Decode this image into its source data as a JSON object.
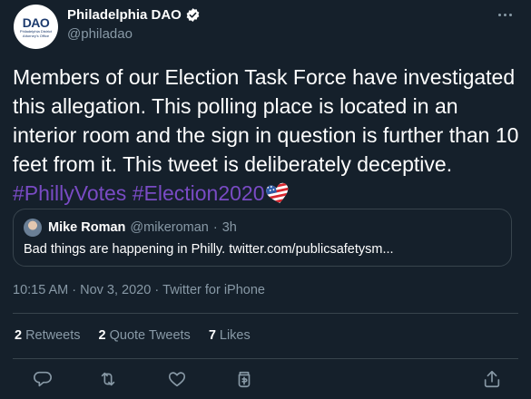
{
  "author": {
    "display_name": "Philadelphia DAO",
    "handle": "@philadao",
    "logo_text": "DAO",
    "logo_sub": "Philadelphia District Attorney's Office"
  },
  "tweet": {
    "text_before": "Members of our Election Task Force have investigated this allegation. This polling place is located in an interior room and the sign in question is further than 10 feet from it. This tweet is deliberately deceptive. ",
    "hashtag_1": "#PhillyVotes",
    "hashtag_2": "#Election2020"
  },
  "quote": {
    "name": "Mike Roman",
    "handle": "@mikeroman",
    "separator": "·",
    "time": "3h",
    "text": "Bad things are happening in Philly. twitter.com/publicsafetysm..."
  },
  "meta": {
    "time": "10:15 AM",
    "separator_1": "·",
    "date": "Nov 3, 2020",
    "separator_2": "·",
    "source": "Twitter for iPhone"
  },
  "stats": {
    "retweets_count": "2",
    "retweets_label": "Retweets",
    "quotes_count": "2",
    "quotes_label": "Quote Tweets",
    "likes_count": "7",
    "likes_label": "Likes"
  },
  "icons": {
    "verified": "verified-badge-icon",
    "more": "more-options-icon",
    "reply": "reply-icon",
    "retweet": "retweet-icon",
    "like": "like-heart-icon",
    "tip": "tip-jar-icon",
    "share": "share-icon",
    "flag": "us-flag-heart-icon"
  },
  "colors": {
    "background": "#15202b",
    "text": "#ffffff",
    "muted": "#8899a6",
    "hashtag": "#794bc4",
    "border": "#38444d"
  }
}
